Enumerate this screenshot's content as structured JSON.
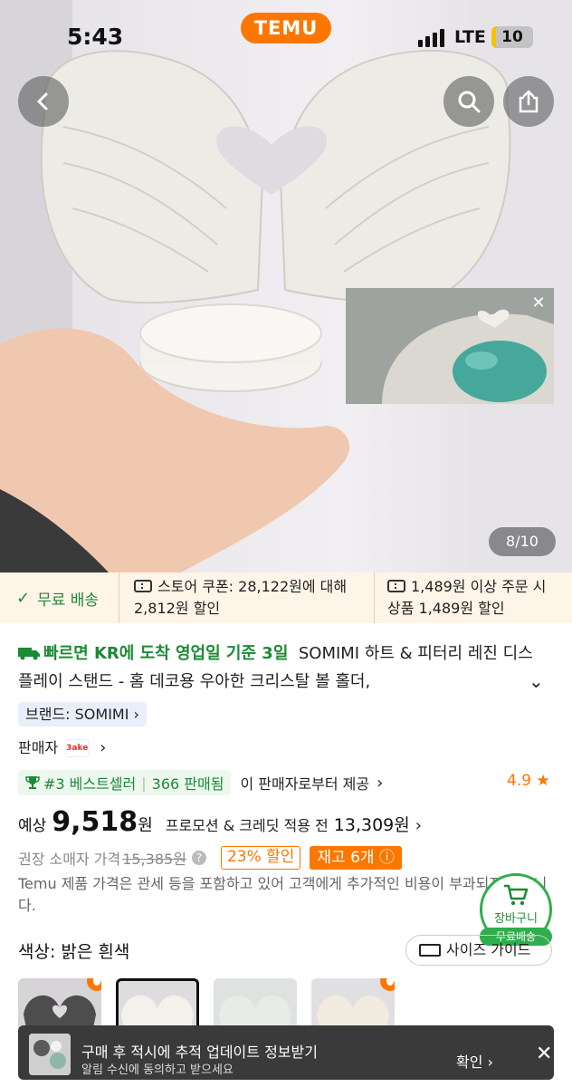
{
  "status": {
    "time": "5:43",
    "network": "LTE",
    "battery": "10"
  },
  "header": {
    "logo": "TEMU"
  },
  "gallery": {
    "counter": "8/10"
  },
  "promo": {
    "shipping": "무료 배송",
    "store_coupon": "스토어 쿠폰: 28,122원에 대해 2,812원 할인",
    "order_coupon_l1": "1,489원 이상 주문 시",
    "order_coupon_l2": "상품 1,489원 할인"
  },
  "product": {
    "fast_delivery": "빠르면 KR에 도착 영업일 기준 3일",
    "title": "SOMIMI 하트 & 피터리 레진 디스플레이 스탠드 - 홈 데코용 우아한 크리스탈 볼 홀더,",
    "brand": "브랜드: SOMIMI",
    "seller_label": "판매자",
    "seller_logo": "3ake",
    "bestseller": "#3 베스트셀러",
    "sold": "366 판매됨",
    "provided_by": "이 판매자로부터 제공",
    "rating": "4.9",
    "price_prefix": "예상",
    "price": "9,518",
    "price_unit": "원",
    "price_note": "프로모션 & 크레딧 적용 전",
    "price_before": "13,309원",
    "rrp_label": "권장 소매자 가격",
    "rrp_value": "15,385원",
    "discount": "23% 할인",
    "stock": "재고 6개",
    "disclaimer": "Temu 제품 가격은 관세 등을 포함하고 있어 고객에게 추가적인 비용이 부과되지 않습니다.",
    "color_label": "색상: 밝은 흰색",
    "size_guide": "사이즈 가이드"
  },
  "cart": {
    "label": "장바구니",
    "badge": "무료배송"
  },
  "toast": {
    "title": "구매 후 적시에 추적 업데이트 정보받기",
    "subtitle": "알림 수신에 동의하고 받으세요",
    "confirm": "확인"
  }
}
